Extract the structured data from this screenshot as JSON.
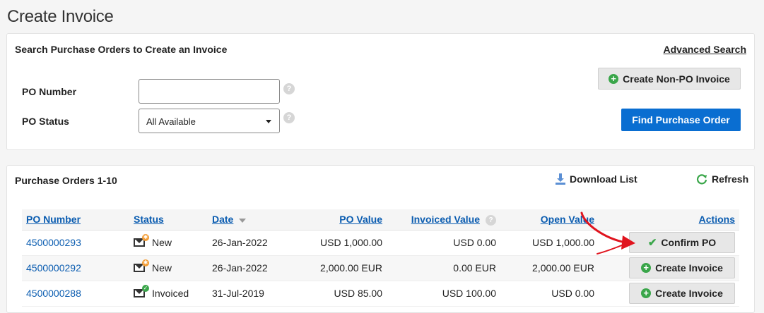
{
  "page": {
    "title": "Create Invoice"
  },
  "search": {
    "title": "Search Purchase Orders to Create an Invoice",
    "advanced_search": "Advanced Search",
    "po_number_label": "PO Number",
    "po_number_value": "",
    "po_status_label": "PO Status",
    "po_status_value": "All Available",
    "help_glyph": "?",
    "create_non_po_label": "Create Non-PO Invoice",
    "find_po_label": "Find Purchase Order"
  },
  "orders": {
    "title": "Purchase Orders 1-10",
    "download_label": "Download List",
    "refresh_label": "Refresh",
    "columns": {
      "po_number": "PO Number",
      "status": "Status",
      "date": "Date",
      "po_value": "PO Value",
      "invoiced_value": "Invoiced Value",
      "open_value": "Open Value",
      "actions": "Actions"
    },
    "rows": [
      {
        "po_number": "4500000293",
        "status": "New",
        "date": "26-Jan-2022",
        "po_value": "USD 1,000.00",
        "invoiced_value": "USD 0.00",
        "open_value": "USD 1,000.00",
        "action": "Confirm PO"
      },
      {
        "po_number": "4500000292",
        "status": "New",
        "date": "26-Jan-2022",
        "po_value": "2,000.00 EUR",
        "invoiced_value": "0.00 EUR",
        "open_value": "2,000.00 EUR",
        "action": "Create Invoice"
      },
      {
        "po_number": "4500000288",
        "status": "Invoiced",
        "date": "31-Jul-2019",
        "po_value": "USD 85.00",
        "invoiced_value": "USD 100.00",
        "open_value": "USD 0.00",
        "action": "Create Invoice"
      }
    ]
  },
  "colors": {
    "accent": "#0a6ed1",
    "link": "#0a5cb0",
    "plus_green": "#3aa64a",
    "annotation_red": "#e0141e"
  }
}
